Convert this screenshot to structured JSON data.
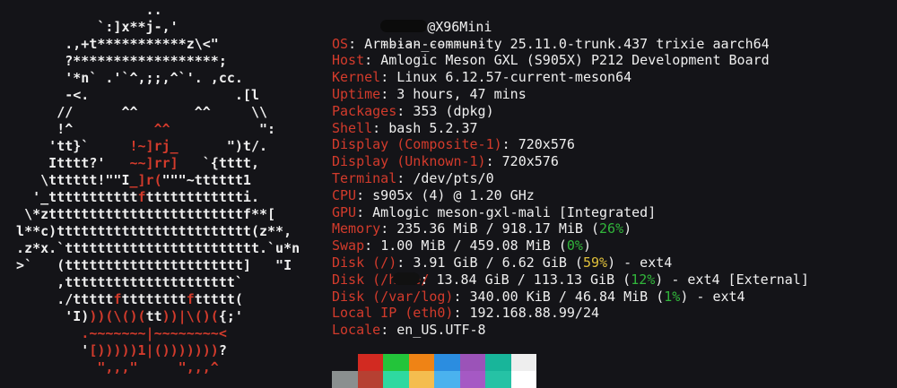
{
  "logo_lines": [
    [
      {
        "t": "                  ..",
        "c": "w"
      }
    ],
    [
      {
        "t": "            `:]x**j-,'",
        "c": "w"
      }
    ],
    [
      {
        "t": "        .,+t***********z\\<\"",
        "c": "w"
      }
    ],
    [
      {
        "t": "        ?******************;",
        "c": "w"
      }
    ],
    [
      {
        "t": "        '*n` .'`^,;;,^`'. ,cc.",
        "c": "w"
      }
    ],
    [
      {
        "t": "        -<.                  .[l",
        "c": "w"
      }
    ],
    [
      {
        "t": "       //      ^^       ^^     \\\\",
        "c": "w"
      }
    ],
    [
      {
        "t": "       !^          ",
        "c": "w"
      },
      {
        "t": "^^",
        "c": "r"
      },
      {
        "t": "           \":",
        "c": "w"
      }
    ],
    [
      {
        "t": "      'tt}`     ",
        "c": "w"
      },
      {
        "t": "!~]rj_",
        "c": "r"
      },
      {
        "t": "      \")t/.",
        "c": "w"
      }
    ],
    [
      {
        "t": "      Itttt?'   ",
        "c": "w"
      },
      {
        "t": "~~]rr]",
        "c": "r"
      },
      {
        "t": "   `{tttt,",
        "c": "w"
      }
    ],
    [
      {
        "t": "     \\tttttt!\"\"I",
        "c": "w"
      },
      {
        "t": "_]r(",
        "c": "r"
      },
      {
        "t": "\"\"\"~tttttt1",
        "c": "w"
      }
    ],
    [
      {
        "t": "    '_ttttttttttt",
        "c": "w"
      },
      {
        "t": "f",
        "c": "r"
      },
      {
        "t": "tttttttttttti.",
        "c": "w"
      }
    ],
    [
      {
        "t": "   \\*zttttttttttttttttttttttttf**[",
        "c": "w"
      }
    ],
    [
      {
        "t": "  l**c)tttttttttttttttttttttttt(z**,",
        "c": "w"
      }
    ],
    [
      {
        "t": "  .z*x.`tttttttttttttttttttttttt.`u*n",
        "c": "w"
      }
    ],
    [
      {
        "t": "  >`   (tttttttttttttttttttttt]   \"I",
        "c": "w"
      }
    ],
    [
      {
        "t": "       ,ttttttttttttttttttttt`",
        "c": "w"
      }
    ],
    [
      {
        "t": "       ./ttttt",
        "c": "w"
      },
      {
        "t": "f",
        "c": "r"
      },
      {
        "t": "tttttttt",
        "c": "w"
      },
      {
        "t": "f",
        "c": "r"
      },
      {
        "t": "ttttt(",
        "c": "w"
      }
    ],
    [
      {
        "t": "        'I)",
        "c": "w"
      },
      {
        "t": "))(\\()(",
        "c": "r"
      },
      {
        "t": "tt",
        "c": "w"
      },
      {
        "t": "))|\\()(",
        "c": "r"
      },
      {
        "t": "{;'",
        "c": "w"
      }
    ],
    [
      {
        "t": "          ",
        "c": "w"
      },
      {
        "t": ".~~~~~~~|~~~~~~~~<",
        "c": "r"
      }
    ],
    [
      {
        "t": "          '",
        "c": "w"
      },
      {
        "t": "[)))))1|()))))))",
        "c": "r"
      },
      {
        "t": "?",
        "c": "w"
      }
    ],
    [
      {
        "t": "            ",
        "c": "w"
      },
      {
        "t": "\",,,\"     \",,,^",
        "c": "r"
      }
    ]
  ],
  "header": {
    "host_suffix": "@X96Mini",
    "separator": "-------------"
  },
  "info": [
    {
      "key": "OS",
      "value": "Armbian_community 25.11.0-trunk.437 trixie aarch64"
    },
    {
      "key": "Host",
      "value": "Amlogic Meson GXL (S905X) P212 Development Board"
    },
    {
      "key": "Kernel",
      "value": "Linux 6.12.57-current-meson64"
    },
    {
      "key": "Uptime",
      "value": "3 hours, 47 mins"
    },
    {
      "key": "Packages",
      "value": "353 (dpkg)"
    },
    {
      "key": "Shell",
      "value": "bash 5.2.37"
    },
    {
      "key": "Display (Composite-1)",
      "value": "720x576"
    },
    {
      "key": "Display (Unknown-1)",
      "value": "720x576"
    },
    {
      "key": "Terminal",
      "value": "/dev/pts/0"
    },
    {
      "key": "CPU",
      "value": "s905x (4) @ 1.20 GHz"
    },
    {
      "key": "GPU",
      "value": "Amlogic meson-gxl-mali [Integrated]"
    },
    {
      "key": "Memory",
      "pre": "235.36 MiB / 918.17 MiB (",
      "pct": "26%",
      "pct_color": "green",
      "post": ")"
    },
    {
      "key": "Swap",
      "pre": "1.00 MiB / 459.08 MiB (",
      "pct": "0%",
      "pct_color": "green",
      "post": ")"
    },
    {
      "key": "Disk (/)",
      "pre": "3.91 GiB / 6.62 GiB (",
      "pct": "59%",
      "pct_color": "yellow",
      "post": ") - ext4"
    },
    {
      "key": "Disk (/home/",
      "smudge": true,
      "pre": "13.84 GiB / 113.13 GiB (",
      "pct": "12%",
      "pct_color": "green",
      "post": ") - ext4 [External]"
    },
    {
      "key": "Disk (/var/log)",
      "pre": "340.00 KiB / 46.84 MiB (",
      "pct": "1%",
      "pct_color": "green",
      "post": ") - ext4"
    },
    {
      "key": "Local IP (eth0)",
      "value": "192.168.88.99/24"
    },
    {
      "key": "Locale",
      "value": "en_US.UTF-8"
    }
  ],
  "palette": {
    "top": [
      "#141418",
      "#d22a21",
      "#23c43a",
      "#ef8315",
      "#2b8de0",
      "#9b53b8",
      "#18b59a",
      "#eeeeee"
    ],
    "bottom": [
      "#8a8f8f",
      "#b64032",
      "#2ed9a0",
      "#f4bd4f",
      "#4ab2ee",
      "#a559c4",
      "#26c2a5",
      "#ffffff"
    ]
  },
  "colors": {
    "key": "#d33b2c",
    "text": "#efefef",
    "green": "#31b63b",
    "yellow": "#e0c03a",
    "background": "#141418"
  }
}
